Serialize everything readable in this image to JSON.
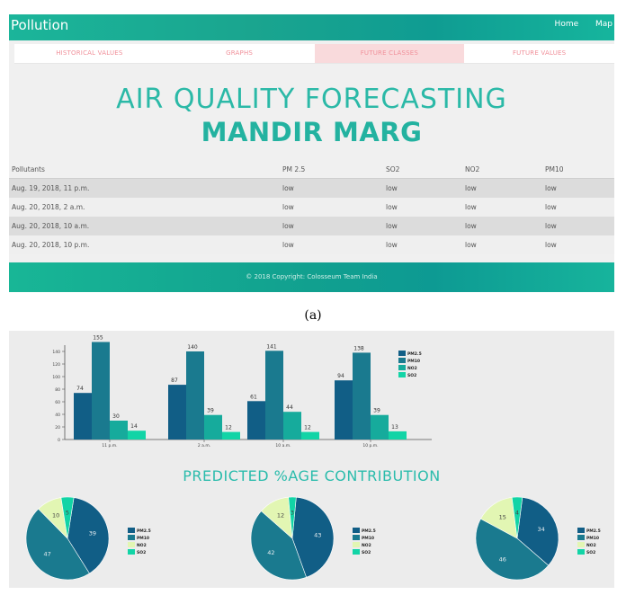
{
  "navbar": {
    "brand": "Pollution",
    "links": [
      "Home",
      "Map"
    ]
  },
  "tabs": [
    "HISTORICAL VALUES",
    "GRAPHS",
    "FUTURE CLASSES",
    "FUTURE VALUES"
  ],
  "hero": {
    "line1": "AIR QUALITY FORECASTING",
    "line2": "MANDIR MARG"
  },
  "table": {
    "headers": [
      "Pollutants",
      "PM 2.5",
      "SO2",
      "NO2",
      "PM10"
    ],
    "rows": [
      [
        "Aug. 19, 2018, 11 p.m.",
        "low",
        "low",
        "low",
        "low"
      ],
      [
        "Aug. 20, 2018, 2 a.m.",
        "low",
        "low",
        "low",
        "low"
      ],
      [
        "Aug. 20, 2018, 10 a.m.",
        "low",
        "low",
        "low",
        "low"
      ],
      [
        "Aug. 20, 2018, 10 p.m.",
        "low",
        "low",
        "low",
        "low"
      ]
    ]
  },
  "footer": {
    "text": "© 2018 Copyright: Colosseum Team India"
  },
  "captions": {
    "a": "(a)"
  },
  "percent_title": "PREDICTED %AGE CONTRIBUTION",
  "colors": {
    "pm25": "#115e86",
    "pm10": "#1a7a8f",
    "no2": "#16ab9c",
    "so2": "#12d4a6",
    "no2_pie": "#e2f6b3",
    "so2_pie": "#12d4a6"
  },
  "chart_data": [
    {
      "type": "bar",
      "categories": [
        "11 p.m.",
        "2 a.m.",
        "10 a.m.",
        "10 p.m."
      ],
      "series": [
        {
          "name": "PM2.5",
          "values": [
            74,
            87,
            61,
            94
          ]
        },
        {
          "name": "PM10",
          "values": [
            155,
            140,
            141,
            138
          ]
        },
        {
          "name": "NO2",
          "values": [
            30,
            39,
            44,
            39
          ]
        },
        {
          "name": "SO2",
          "values": [
            14,
            12,
            12,
            13
          ]
        }
      ],
      "yticks": [
        0,
        20,
        40,
        60,
        80,
        100,
        120,
        140
      ],
      "ylim": [
        0,
        160
      ],
      "legend": "top-right"
    },
    {
      "type": "pie",
      "labels": [
        "PM2.5",
        "PM10",
        "NO2",
        "SO2"
      ],
      "values": [
        39,
        47,
        10,
        5
      ]
    },
    {
      "type": "pie",
      "labels": [
        "PM2.5",
        "PM10",
        "NO2",
        "SO2"
      ],
      "values": [
        43,
        42,
        12,
        3
      ]
    },
    {
      "type": "pie",
      "labels": [
        "PM2.5",
        "PM10",
        "NO2",
        "SO2"
      ],
      "values": [
        34,
        46,
        15,
        4
      ]
    }
  ]
}
